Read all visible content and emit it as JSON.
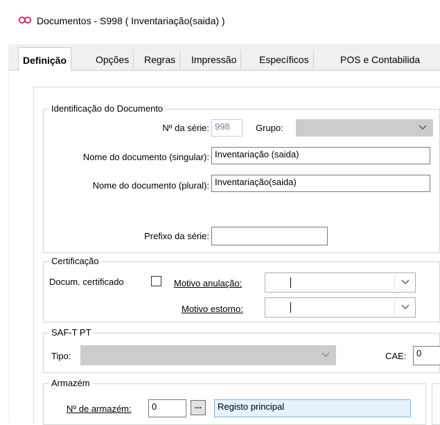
{
  "window": {
    "title": "Documentos - S998 ( Inventariação(saida) )",
    "icon": "infinity-icon"
  },
  "tabs": [
    "Definição",
    "Opções",
    "Regras",
    "Impressão",
    "Específicos",
    "POS e Contabilida"
  ],
  "identificacao": {
    "legend": "Identificação do Documento",
    "serie_label": "Nº da série:",
    "serie_value": "998",
    "grupo_label": "Grupo:",
    "grupo_value": "",
    "nome_singular_label": "Nome do documento (singular):",
    "nome_singular_value": "Inventariação (saida)",
    "nome_plural_label": "Nome do documento (plural):",
    "nome_plural_value": "Inventariação(saida)",
    "prefixo_label": "Prefixo da série:",
    "prefixo_value": ""
  },
  "certificacao": {
    "legend": "Certificação",
    "docum_label": "Docum. certificado",
    "docum_checked": false,
    "motivo_anulacao_label": "Motivo anulação:",
    "motivo_anulacao_value": "",
    "motivo_estorno_label": "Motivo estorno:",
    "motivo_estorno_value": ""
  },
  "saft": {
    "legend": "SAF-T PT",
    "tipo_label": "Tipo:",
    "tipo_value": "",
    "cae_label": "CAE:",
    "cae_value": "0"
  },
  "armazem": {
    "legend": "Armazém",
    "numero_label": "Nº de armazém:",
    "numero_value": "0",
    "browse_label": "...",
    "descricao_value": "Registo principal"
  },
  "colors": {
    "highlight": "#e5f1fb",
    "disabled_text": "#7a7aa8"
  }
}
